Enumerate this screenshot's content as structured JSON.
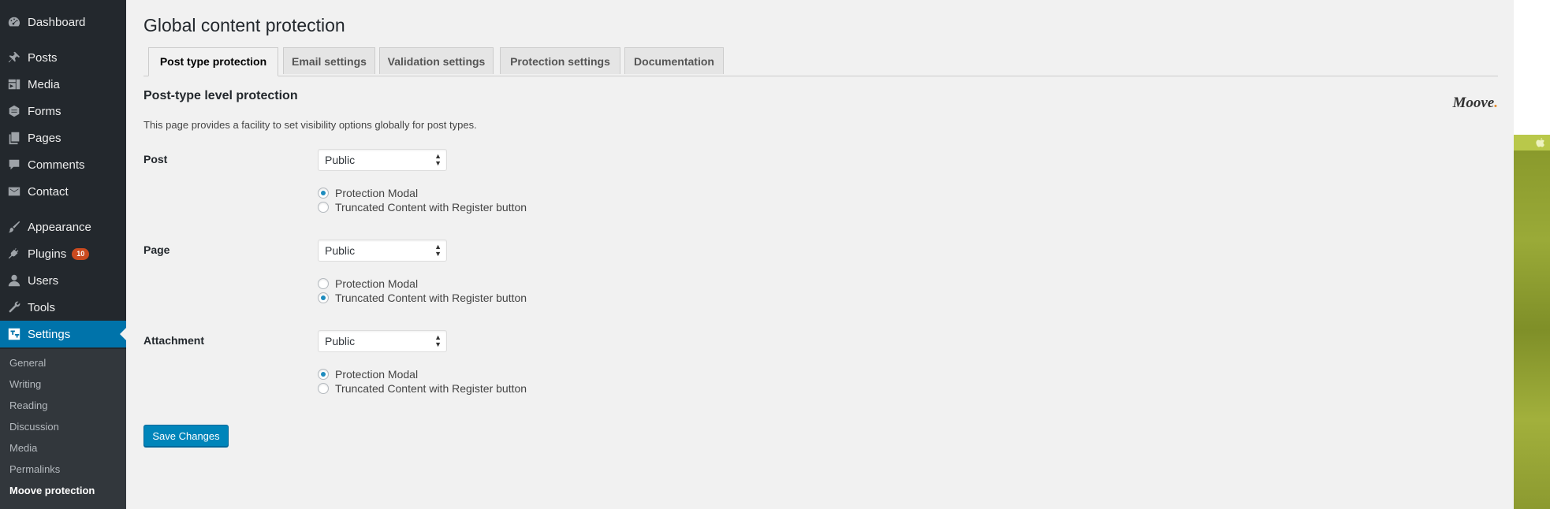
{
  "sidebar": {
    "items": [
      {
        "key": "dashboard",
        "label": "Dashboard",
        "icon": "dashboard-icon"
      },
      {
        "key": "posts",
        "label": "Posts",
        "icon": "pin-icon"
      },
      {
        "key": "media",
        "label": "Media",
        "icon": "media-icon"
      },
      {
        "key": "forms",
        "label": "Forms",
        "icon": "forms-icon"
      },
      {
        "key": "pages",
        "label": "Pages",
        "icon": "pages-icon"
      },
      {
        "key": "comments",
        "label": "Comments",
        "icon": "comment-icon"
      },
      {
        "key": "contact",
        "label": "Contact",
        "icon": "envelope-icon"
      },
      {
        "key": "appearance",
        "label": "Appearance",
        "icon": "brush-icon"
      },
      {
        "key": "plugins",
        "label": "Plugins",
        "icon": "plug-icon",
        "badge": "10"
      },
      {
        "key": "users",
        "label": "Users",
        "icon": "user-icon"
      },
      {
        "key": "tools",
        "label": "Tools",
        "icon": "wrench-icon"
      },
      {
        "key": "settings",
        "label": "Settings",
        "icon": "settings-icon",
        "current": true
      }
    ],
    "submenu": [
      {
        "label": "General"
      },
      {
        "label": "Writing"
      },
      {
        "label": "Reading"
      },
      {
        "label": "Discussion"
      },
      {
        "label": "Media"
      },
      {
        "label": "Permalinks"
      },
      {
        "label": "Moove protection",
        "current": true
      }
    ]
  },
  "page": {
    "title": "Global content protection",
    "tabs": [
      {
        "label": "Post type protection",
        "active": true
      },
      {
        "label": "Email settings"
      },
      {
        "label": "Validation settings"
      },
      {
        "label": "Protection settings"
      },
      {
        "label": "Documentation"
      }
    ],
    "section_title": "Post-type level protection",
    "brand": {
      "name": "Moove",
      "dot": ".",
      "dot_color": "#e38a2b"
    },
    "description": "This page provides a facility to set visibility options globally for post types.",
    "rows": [
      {
        "label": "Post",
        "select_value": "Public",
        "options": [
          {
            "label": "Protection Modal",
            "checked": true
          },
          {
            "label": "Truncated Content with Register button",
            "checked": false
          }
        ]
      },
      {
        "label": "Page",
        "select_value": "Public",
        "options": [
          {
            "label": "Protection Modal",
            "checked": false
          },
          {
            "label": "Truncated Content with Register button",
            "checked": true
          }
        ]
      },
      {
        "label": "Attachment",
        "select_value": "Public",
        "options": [
          {
            "label": "Protection Modal",
            "checked": true
          },
          {
            "label": "Truncated Content with Register button",
            "checked": false
          }
        ]
      }
    ],
    "save_label": "Save Changes"
  },
  "colors": {
    "sidebar_bg": "#23282d",
    "submenu_bg": "#32373c",
    "accent": "#0073aa",
    "button": "#0085ba",
    "badge": "#ca4a1f",
    "radio_checked": "#1e8cbe"
  }
}
